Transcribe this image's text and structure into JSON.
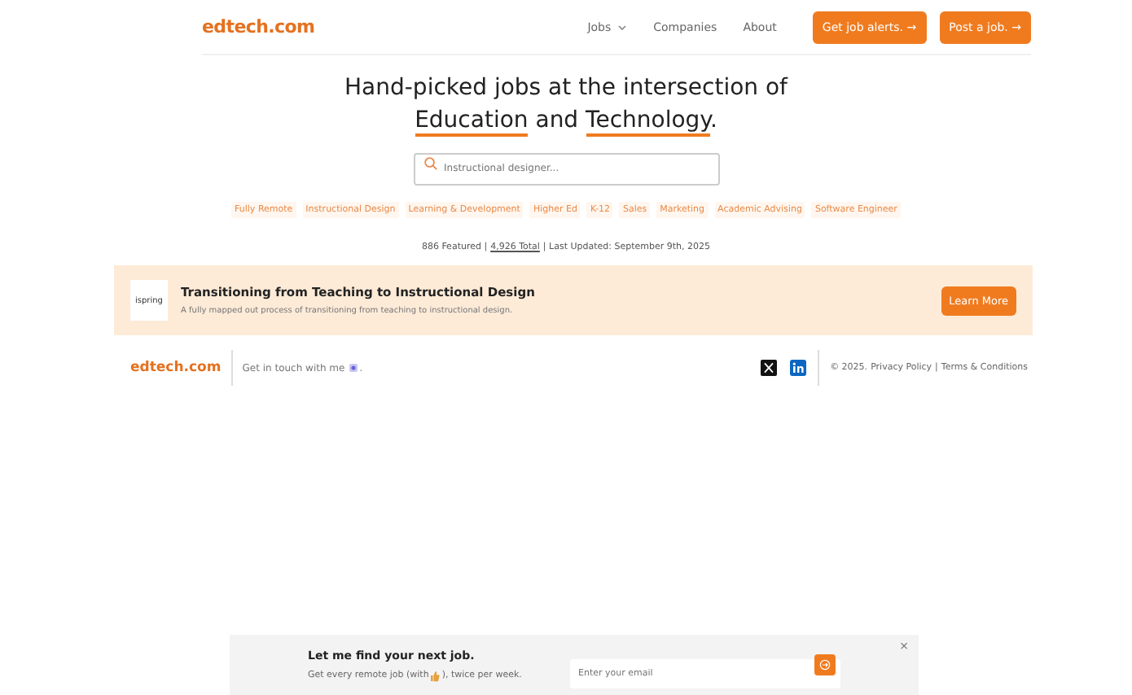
{
  "header": {
    "logo": "edtech.com",
    "nav": [
      {
        "label": "Jobs",
        "dropdown": true
      },
      {
        "label": "Companies",
        "dropdown": false
      },
      {
        "label": "About",
        "dropdown": false
      }
    ],
    "buttons": [
      "Get job alerts. →",
      "Post a job. →"
    ]
  },
  "hero": {
    "line1": "Hand-picked jobs at the intersection of",
    "highlight1": "Education",
    "joiner": "and",
    "highlight2": "Technology",
    "end": "."
  },
  "search": {
    "placeholder": "Instructional designer..."
  },
  "tags": [
    "Fully Remote",
    "Instructional Design",
    "Learning & Development",
    "Higher Ed",
    "K-12",
    "Sales",
    "Marketing",
    "Academic Advising",
    "Software Engineer"
  ],
  "stats": {
    "featured": "886 Featured |",
    "total": "4,926 Total",
    "updated": "| Last Updated: September 9th, 2025"
  },
  "promo": {
    "logo": "ispring",
    "title": "Transitioning from Teaching to Instructional Design",
    "description": "A fully mapped out process of transitioning from teaching to instructional design.",
    "button": "Learn More"
  },
  "footer": {
    "logo": "edtech.com",
    "contact": "Get in touch with me",
    "contact_end": ".",
    "copyright": "© 2025.",
    "links": [
      "Privacy Policy",
      "Terms & Conditions"
    ],
    "separator": "|"
  },
  "signup": {
    "title": "Let me find your next job.",
    "text_start": "Get every remote job (with",
    "text_end": "), twice per week.",
    "placeholder": "Enter your email",
    "close": "×"
  }
}
